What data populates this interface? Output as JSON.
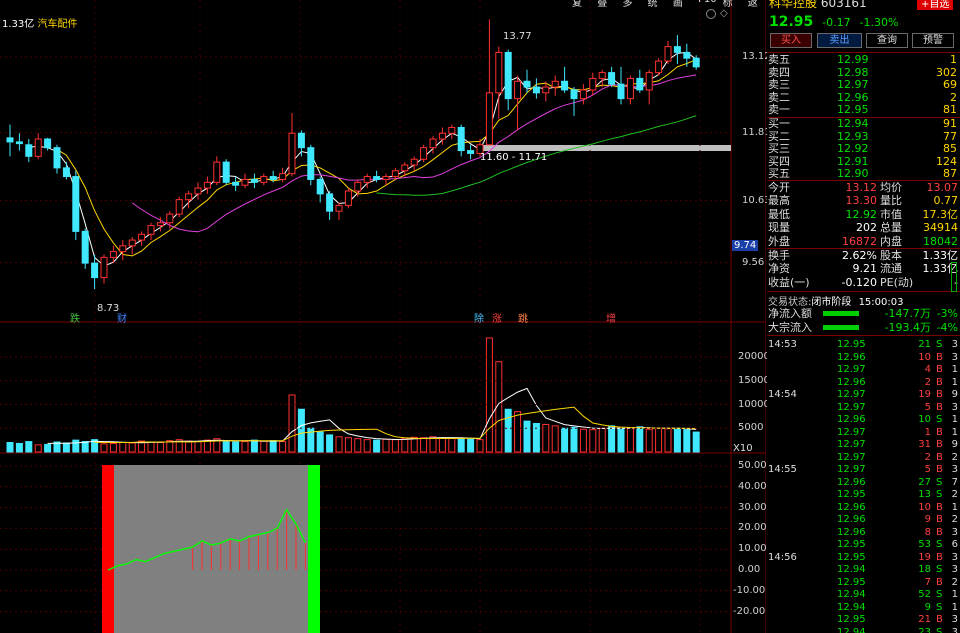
{
  "toolbar": {
    "items": [
      "复权",
      "叠加",
      "多股",
      "统计",
      "画线",
      "F10",
      "标记",
      "返回"
    ]
  },
  "stock": {
    "name": "科华控股",
    "code": "603161",
    "price": "12.95",
    "change": "-0.17",
    "pct": "-1.30%",
    "tag": "+自选"
  },
  "header": {
    "amount": "1.33亿",
    "sector": "汽车配件"
  },
  "buttons": [
    "买入",
    "卖出",
    "查询",
    "预警"
  ],
  "asks": [
    {
      "label": "卖五",
      "price": "12.99",
      "vol": "1"
    },
    {
      "label": "卖四",
      "price": "12.98",
      "vol": "302"
    },
    {
      "label": "卖三",
      "price": "12.97",
      "vol": "69"
    },
    {
      "label": "卖二",
      "price": "12.96",
      "vol": "2"
    },
    {
      "label": "卖一",
      "price": "12.95",
      "vol": "81"
    }
  ],
  "bids": [
    {
      "label": "买一",
      "price": "12.94",
      "vol": "91"
    },
    {
      "label": "买二",
      "price": "12.93",
      "vol": "77"
    },
    {
      "label": "买三",
      "price": "12.92",
      "vol": "85"
    },
    {
      "label": "买四",
      "price": "12.91",
      "vol": "124"
    },
    {
      "label": "买五",
      "price": "12.90",
      "vol": "87"
    }
  ],
  "stats": [
    {
      "l1": "今开",
      "v1": "13.12",
      "l2": "均价",
      "v2": "13.07"
    },
    {
      "l1": "最高",
      "v1": "13.30",
      "l2": "量比",
      "v2": "0.77"
    },
    {
      "l1": "最低",
      "v1": "12.92",
      "l2": "市值",
      "v2": "17.3亿"
    },
    {
      "l1": "现量",
      "v1": "202",
      "l2": "总量",
      "v2": "34914"
    },
    {
      "l1": "外盘",
      "v1": "16872",
      "l2": "内盘",
      "v2": "18042"
    }
  ],
  "stats2": [
    {
      "l1": "换手",
      "v1": "2.62%",
      "l2": "股本",
      "v2": "1.33亿"
    },
    {
      "l1": "净资",
      "v1": "9.21",
      "l2": "流通",
      "v2": "1.33亿"
    },
    {
      "l1": "收益(一)",
      "v1": "-0.120",
      "l2": "PE(动)",
      "v2": "-"
    }
  ],
  "status": {
    "label": "交易状态:",
    "value": "闭市阶段",
    "time": "15:00:03"
  },
  "flows": [
    {
      "label": "净流入额",
      "value": "-147.7万",
      "pct": "-3%"
    },
    {
      "label": "大宗流入",
      "value": "-193.4万",
      "pct": "-4%"
    }
  ],
  "trades": [
    {
      "t": "14:53",
      "p": "12.95",
      "v": "21",
      "s": "S",
      "n": "3"
    },
    {
      "t": "",
      "p": "12.96",
      "v": "10",
      "s": "B",
      "n": "3"
    },
    {
      "t": "",
      "p": "12.97",
      "v": "4",
      "s": "B",
      "n": "1"
    },
    {
      "t": "",
      "p": "12.96",
      "v": "2",
      "s": "B",
      "n": "1"
    },
    {
      "t": "14:54",
      "p": "12.97",
      "v": "19",
      "s": "B",
      "n": "9"
    },
    {
      "t": "",
      "p": "12.97",
      "v": "5",
      "s": "B",
      "n": "3"
    },
    {
      "t": "",
      "p": "12.96",
      "v": "10",
      "s": "S",
      "n": "1"
    },
    {
      "t": "",
      "p": "12.97",
      "v": "1",
      "s": "B",
      "n": "1"
    },
    {
      "t": "",
      "p": "12.97",
      "v": "31",
      "s": "B",
      "n": "9"
    },
    {
      "t": "",
      "p": "12.97",
      "v": "2",
      "s": "B",
      "n": "2"
    },
    {
      "t": "14:55",
      "p": "12.97",
      "v": "5",
      "s": "B",
      "n": "3"
    },
    {
      "t": "",
      "p": "12.96",
      "v": "27",
      "s": "S",
      "n": "7"
    },
    {
      "t": "",
      "p": "12.95",
      "v": "13",
      "s": "S",
      "n": "2"
    },
    {
      "t": "",
      "p": "12.96",
      "v": "10",
      "s": "B",
      "n": "1"
    },
    {
      "t": "",
      "p": "12.96",
      "v": "9",
      "s": "B",
      "n": "2"
    },
    {
      "t": "",
      "p": "12.96",
      "v": "8",
      "s": "B",
      "n": "3"
    },
    {
      "t": "",
      "p": "12.95",
      "v": "53",
      "s": "S",
      "n": "6"
    },
    {
      "t": "14:56",
      "p": "12.95",
      "v": "19",
      "s": "B",
      "n": "3"
    },
    {
      "t": "",
      "p": "12.94",
      "v": "18",
      "s": "S",
      "n": "3"
    },
    {
      "t": "",
      "p": "12.95",
      "v": "7",
      "s": "B",
      "n": "2"
    },
    {
      "t": "",
      "p": "12.94",
      "v": "52",
      "s": "S",
      "n": "1"
    },
    {
      "t": "",
      "p": "12.94",
      "v": "9",
      "s": "S",
      "n": "1"
    },
    {
      "t": "",
      "p": "12.95",
      "v": "21",
      "s": "B",
      "n": "3"
    },
    {
      "t": "",
      "p": "12.94",
      "v": "23",
      "s": "S",
      "n": "3"
    }
  ],
  "price_axis": [
    "13.12",
    "11.81",
    "10.63",
    "9.56"
  ],
  "price_marker": "9.74",
  "vol_axis": [
    "20000",
    "15000",
    "10000",
    "5000"
  ],
  "vol_unit": "X10",
  "osc_axis": [
    "50.00",
    "40.00",
    "30.00",
    "20.00",
    "10.00",
    "0.00",
    "-10.00",
    "-20.00"
  ],
  "annotations": {
    "high": "13.77",
    "low": "8.73",
    "range": "11.60 - 11.71"
  },
  "events": [
    "跌",
    "财",
    "除",
    "涨",
    "跳",
    "增"
  ],
  "chart_data": {
    "type": "candlestick",
    "candles": [
      [
        11.72,
        11.95,
        11.4,
        11.65
      ],
      [
        11.65,
        11.8,
        11.5,
        11.62
      ],
      [
        11.6,
        11.7,
        11.3,
        11.4
      ],
      [
        11.4,
        11.8,
        11.35,
        11.7
      ],
      [
        11.7,
        11.72,
        11.5,
        11.55
      ],
      [
        11.55,
        11.6,
        11.1,
        11.2
      ],
      [
        11.2,
        11.3,
        11.0,
        11.05
      ],
      [
        11.05,
        11.15,
        9.95,
        10.1
      ],
      [
        10.1,
        10.15,
        9.45,
        9.55
      ],
      [
        9.55,
        9.7,
        9.1,
        9.3
      ],
      [
        9.3,
        9.7,
        9.2,
        9.65
      ],
      [
        9.65,
        9.85,
        9.55,
        9.75
      ],
      [
        9.75,
        9.95,
        9.6,
        9.85
      ],
      [
        9.85,
        10.0,
        9.7,
        9.95
      ],
      [
        9.95,
        10.1,
        9.85,
        10.05
      ],
      [
        10.05,
        10.25,
        9.95,
        10.2
      ],
      [
        10.2,
        10.35,
        10.1,
        10.25
      ],
      [
        10.25,
        10.45,
        10.15,
        10.4
      ],
      [
        10.4,
        10.7,
        10.35,
        10.65
      ],
      [
        10.65,
        10.8,
        10.5,
        10.75
      ],
      [
        10.75,
        10.95,
        10.65,
        10.85
      ],
      [
        10.85,
        11.05,
        10.75,
        10.95
      ],
      [
        10.95,
        11.4,
        10.9,
        11.3
      ],
      [
        11.3,
        11.35,
        10.9,
        10.95
      ],
      [
        10.95,
        11.05,
        10.8,
        10.9
      ],
      [
        10.9,
        11.1,
        10.85,
        11.0
      ],
      [
        11.0,
        11.1,
        10.85,
        10.95
      ],
      [
        10.95,
        11.1,
        10.9,
        11.05
      ],
      [
        11.05,
        11.15,
        10.95,
        11.0
      ],
      [
        11.0,
        11.2,
        10.95,
        11.1
      ],
      [
        11.1,
        12.15,
        11.05,
        11.8
      ],
      [
        11.8,
        11.85,
        11.4,
        11.55
      ],
      [
        11.55,
        11.6,
        10.9,
        11.0
      ],
      [
        11.0,
        11.05,
        10.6,
        10.75
      ],
      [
        10.75,
        10.8,
        10.3,
        10.45
      ],
      [
        10.45,
        10.6,
        10.3,
        10.55
      ],
      [
        10.55,
        10.85,
        10.5,
        10.8
      ],
      [
        10.8,
        11.0,
        10.7,
        10.95
      ],
      [
        10.95,
        11.1,
        10.85,
        11.05
      ],
      [
        11.05,
        11.15,
        10.95,
        11.0
      ],
      [
        11.0,
        11.1,
        10.9,
        11.05
      ],
      [
        11.05,
        11.2,
        11.0,
        11.15
      ],
      [
        11.15,
        11.3,
        11.05,
        11.25
      ],
      [
        11.25,
        11.4,
        11.15,
        11.35
      ],
      [
        11.35,
        11.6,
        11.3,
        11.55
      ],
      [
        11.55,
        11.75,
        11.45,
        11.7
      ],
      [
        11.7,
        11.9,
        11.6,
        11.8
      ],
      [
        11.8,
        11.95,
        11.7,
        11.9
      ],
      [
        11.9,
        11.95,
        11.4,
        11.5
      ],
      [
        11.5,
        11.6,
        11.35,
        11.45
      ],
      [
        11.45,
        11.7,
        11.4,
        11.6
      ],
      [
        11.6,
        13.77,
        11.6,
        12.5
      ],
      [
        12.5,
        13.3,
        12.05,
        13.2
      ],
      [
        13.2,
        13.25,
        12.2,
        12.4
      ],
      [
        12.4,
        12.8,
        11.85,
        12.7
      ],
      [
        12.7,
        12.9,
        12.5,
        12.6
      ],
      [
        12.6,
        12.75,
        12.4,
        12.5
      ],
      [
        12.5,
        12.7,
        12.35,
        12.6
      ],
      [
        12.6,
        12.8,
        12.45,
        12.7
      ],
      [
        12.7,
        12.95,
        12.5,
        12.55
      ],
      [
        12.55,
        12.6,
        12.1,
        12.4
      ],
      [
        12.4,
        12.65,
        12.3,
        12.55
      ],
      [
        12.55,
        12.85,
        12.45,
        12.75
      ],
      [
        12.75,
        12.9,
        12.6,
        12.85
      ],
      [
        12.85,
        12.95,
        12.6,
        12.65
      ],
      [
        12.65,
        12.95,
        12.3,
        12.4
      ],
      [
        12.4,
        12.8,
        12.3,
        12.75
      ],
      [
        12.75,
        12.9,
        12.5,
        12.55
      ],
      [
        12.55,
        12.9,
        12.3,
        12.85
      ],
      [
        12.85,
        13.1,
        12.8,
        13.05
      ],
      [
        13.05,
        13.4,
        13.0,
        13.3
      ],
      [
        13.3,
        13.5,
        13.0,
        13.2
      ],
      [
        13.2,
        13.35,
        12.95,
        13.1
      ],
      [
        13.1,
        13.15,
        12.9,
        12.95
      ]
    ],
    "volume": [
      2000,
      1800,
      2200,
      1500,
      1600,
      2100,
      1900,
      2500,
      2200,
      2600,
      1700,
      1800,
      2000,
      1900,
      2300,
      2100,
      2000,
      2400,
      2600,
      2300,
      2200,
      2500,
      2800,
      2300,
      2100,
      2200,
      2500,
      2300,
      2400,
      2200,
      12000,
      9000,
      5000,
      4200,
      3600,
      3200,
      3000,
      2800,
      2600,
      2500,
      2700,
      2600,
      2900,
      3100,
      3000,
      3200,
      3000,
      2900,
      2800,
      2700,
      2600,
      24000,
      19000,
      9000,
      8500,
      6500,
      6000,
      5800,
      5500,
      5000,
      5200,
      4800,
      4700,
      5000,
      5500,
      4900,
      5100,
      5300,
      4800,
      5000,
      4900,
      5000,
      4700,
      4200
    ],
    "osc": [
      0,
      2,
      3,
      5,
      4,
      6,
      8,
      9,
      10,
      11,
      14,
      12,
      13,
      15,
      14,
      16,
      17,
      18,
      20,
      29,
      22,
      13
    ]
  }
}
